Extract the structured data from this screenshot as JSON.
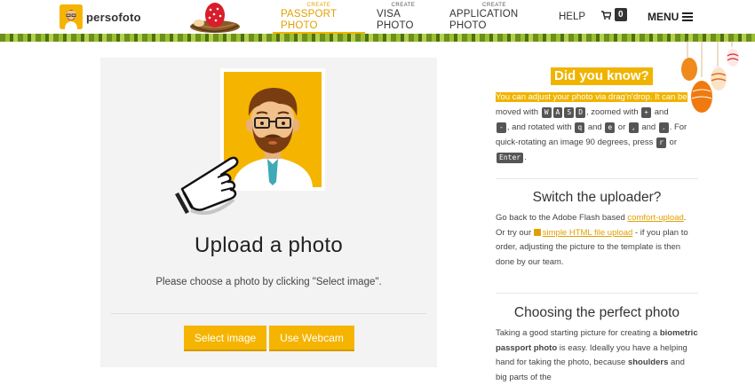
{
  "header": {
    "brand": "persofoto",
    "nav": [
      {
        "small": "CREATE",
        "label": "PASSPORT PHOTO"
      },
      {
        "small": "CREATE",
        "label": "VISA PHOTO"
      },
      {
        "small": "CREATE",
        "label": "APPLICATION PHOTO"
      }
    ],
    "help": "HELP",
    "cart_count": "0",
    "menu": "MENU"
  },
  "upload": {
    "title": "Upload a photo",
    "hint": "Please choose a photo by clicking \"Select image\".",
    "select_button": "Select image",
    "webcam_button": "Use Webcam"
  },
  "sidebar": {
    "dyk_title": "Did you know?",
    "dyk_text_1": "You can adjust your photo via drag'n'drop. It can be",
    "dyk_moved": "moved with",
    "dyk_keys_move": [
      "W",
      "A",
      "S",
      "D"
    ],
    "dyk_zoomed": ", zoomed with",
    "dyk_key_plus": "+",
    "dyk_and": "and",
    "dyk_key_minus": "-",
    "dyk_rotated": ", and rotated with",
    "dyk_key_q": "q",
    "dyk_key_e": "e",
    "dyk_or": "or",
    "dyk_key_comma": ",",
    "dyk_key_dot": ".",
    "dyk_for": ". For",
    "dyk_quick": "quick-rotating an image 90 degrees, press",
    "dyk_key_r": "r",
    "dyk_key_enter": "Enter",
    "dyk_end": ".",
    "switch_title": "Switch the uploader?",
    "switch_p1_a": "Go back to the Adobe Flash based",
    "switch_link1": "comfort-upload",
    "switch_p1_b": ".",
    "switch_p2_a": "Or try our",
    "switch_link2": "simple HTML file upload",
    "switch_p2_b": "- if you plan to order, adjusting the picture to the template is then done by our team.",
    "choose_title": "Choosing the perfect photo",
    "choose_a": "Taking a good starting picture for creating a",
    "choose_b1": "biometric passport photo",
    "choose_c": "is easy. Ideally you have a helping hand for taking the photo, because",
    "choose_d": "shoulders",
    "choose_e": "and big parts of the"
  },
  "colors": {
    "accent": "#f5b400",
    "grass": "#7ea324"
  }
}
